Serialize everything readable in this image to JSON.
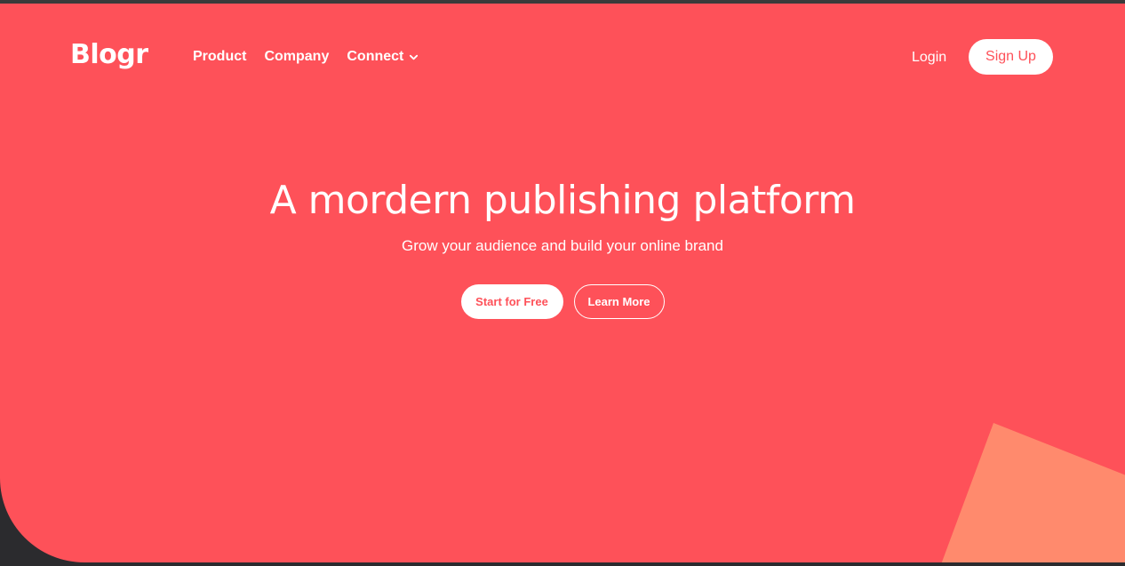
{
  "brand": {
    "name": "Blogr"
  },
  "nav": {
    "items": [
      {
        "label": "Product"
      },
      {
        "label": "Company"
      },
      {
        "label": "Connect",
        "icon": "chevron-down-icon"
      }
    ],
    "login": "Login",
    "signup": "Sign Up"
  },
  "hero": {
    "title": "A mordern publishing platform",
    "subtitle": "Grow your audience and build your online brand",
    "primary_cta": "Start for Free",
    "secondary_cta": "Learn More"
  },
  "colors": {
    "hero_bg": "#fe5159",
    "decor": "#ff8a6d",
    "text": "#ffffff"
  }
}
